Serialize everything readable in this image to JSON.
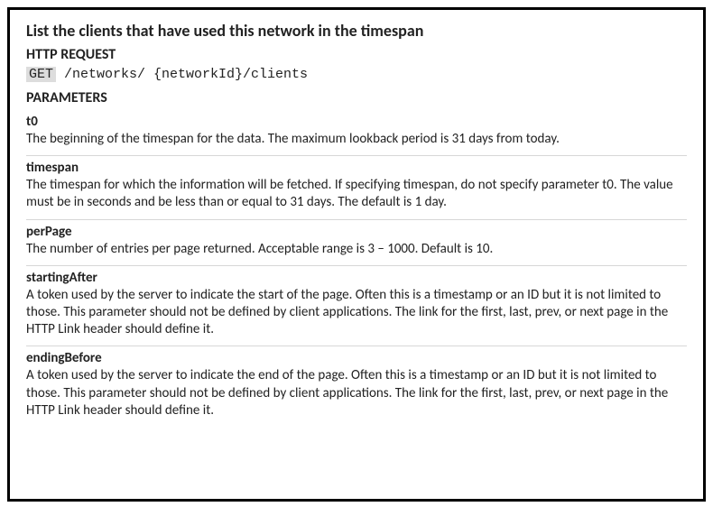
{
  "title": "List the clients that have used this network in the timespan",
  "http": {
    "section_label": "HTTP REQUEST",
    "method": "GET",
    "path": " /networks/ {networkId}/clients"
  },
  "params": {
    "section_label": "PARAMETERS",
    "items": [
      {
        "name": "t0",
        "desc": "The beginning of the timespan for the data. The maximum lookback period is 31 days from today."
      },
      {
        "name": "timespan",
        "desc": "The timespan for which the information will be fetched. If specifying timespan, do not specify parameter t0. The value must be in seconds and be less than or equal to 31 days. The default is 1 day."
      },
      {
        "name": "perPage",
        "desc": "The number of entries per page returned. Acceptable range is 3 – 1000. Default is 10."
      },
      {
        "name": "startingAfter",
        "desc": "A token used by the server to indicate the start of the page. Often this is a timestamp or an ID but it is not limited to those. This parameter should not be defined by client applications. The link for the first, last, prev, or next page in the HTTP Link header should define it."
      },
      {
        "name": "endingBefore",
        "desc": "A token used by the server to indicate the end of the page. Often this is a timestamp or an ID but it is not limited to those. This parameter should not be defined by client applications. The link for the first, last, prev, or next page in the HTTP Link header should define it."
      }
    ]
  }
}
